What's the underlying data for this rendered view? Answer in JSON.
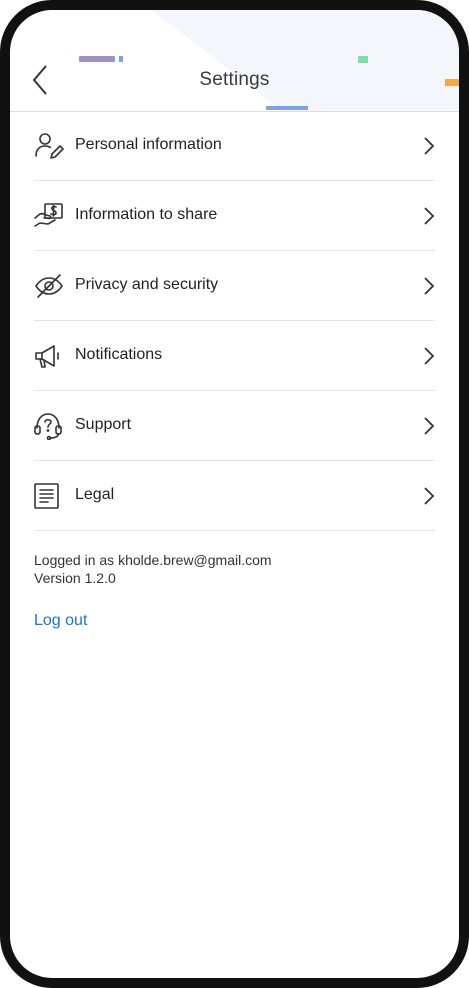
{
  "header": {
    "title": "Settings",
    "back_icon": "back-chevron-icon",
    "accent_colors": [
      "#9e90c0",
      "#7fa3de",
      "#7de0a6",
      "#f2a94a",
      "#f3f6fb"
    ]
  },
  "menu": {
    "items": [
      {
        "label": "Personal information",
        "icon": "person-edit-icon"
      },
      {
        "label": "Information to share",
        "icon": "share-money-icon"
      },
      {
        "label": "Privacy and security",
        "icon": "eye-slash-icon"
      },
      {
        "label": "Notifications",
        "icon": "megaphone-icon"
      },
      {
        "label": "Support",
        "icon": "headset-help-icon"
      },
      {
        "label": "Legal",
        "icon": "document-icon"
      }
    ],
    "chevron_icon": "chevron-right-icon"
  },
  "account": {
    "logged_in_text": "Logged in as kholde.brew@gmail.com",
    "version_text": "Version 1.2.0",
    "logout_label": "Log out",
    "link_color": "#1a73d9"
  }
}
